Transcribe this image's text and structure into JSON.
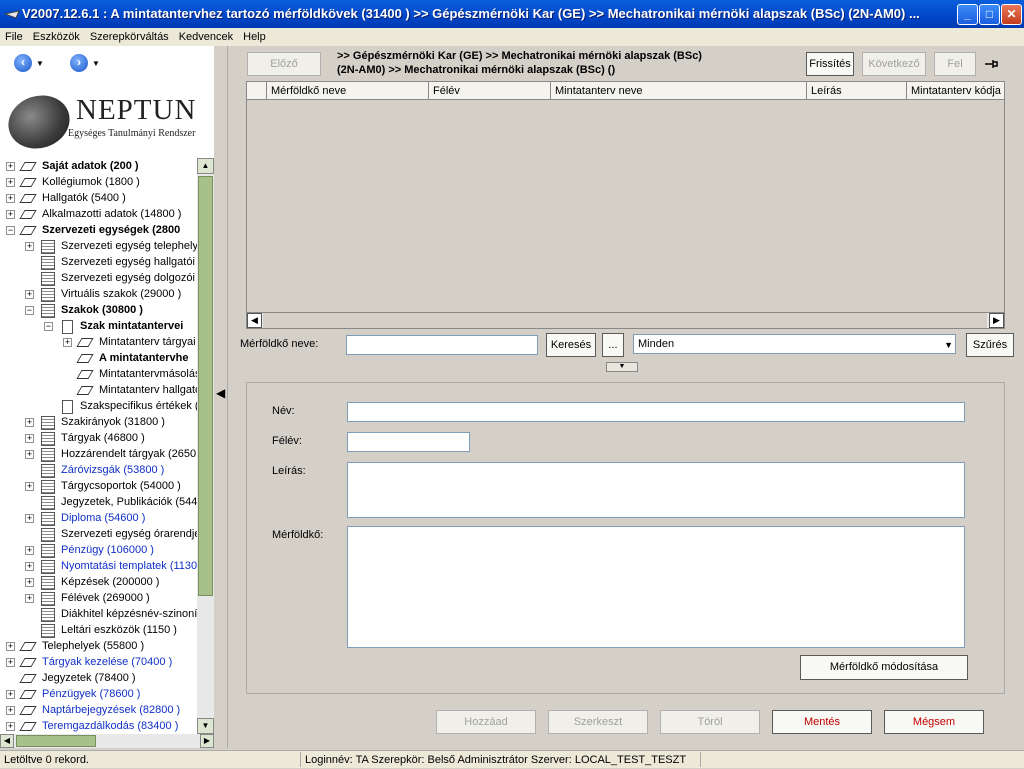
{
  "window": {
    "title": "V2007.12.6.1 : A mintatantervhez tartozó mérföldkövek (31400  ) >> Gépészmérnöki Kar (GE) >> Mechatronikai mérnöki alapszak (BSc) (2N-AM0) ...",
    "minimize": "_",
    "maximize": "□",
    "close": "✕"
  },
  "menu": [
    "File",
    "Eszközök",
    "Szerepkörváltás",
    "Kedvencek",
    "Help"
  ],
  "logo": {
    "title": "NEPTUN",
    "subtitle": "Egységes Tanulmányi Rendszer"
  },
  "tree": [
    {
      "label": "Saját adatok (200  )",
      "level": 0,
      "icon": "book",
      "expander": "+",
      "style": "bold"
    },
    {
      "label": "Kollégiumok (1800  )",
      "level": 0,
      "icon": "book",
      "expander": "+",
      "style": ""
    },
    {
      "label": "Hallgatók (5400  )",
      "level": 0,
      "icon": "book",
      "expander": "+",
      "style": ""
    },
    {
      "label": "Alkalmazotti adatok (14800  )",
      "level": 0,
      "icon": "book",
      "expander": "+",
      "style": ""
    },
    {
      "label": "Szervezeti egységek (2800",
      "level": 0,
      "icon": "book",
      "expander": "−",
      "style": "bold"
    },
    {
      "label": "Szervezeti egység telephelye",
      "level": 1,
      "icon": "folder",
      "expander": "+",
      "style": ""
    },
    {
      "label": "Szervezeti egység hallgatói (",
      "level": 1,
      "icon": "folder",
      "expander": "",
      "style": ""
    },
    {
      "label": "Szervezeti egység dolgozói (",
      "level": 1,
      "icon": "folder",
      "expander": "",
      "style": ""
    },
    {
      "label": "Virtuális szakok (29000  )",
      "level": 1,
      "icon": "folder",
      "expander": "+",
      "style": ""
    },
    {
      "label": "Szakok (30800  )",
      "level": 1,
      "icon": "folder",
      "expander": "−",
      "style": "bold"
    },
    {
      "label": "Szak mintatantervei",
      "level": 2,
      "icon": "doc",
      "expander": "−",
      "style": "bold"
    },
    {
      "label": "Mintatanterv tárgyai",
      "level": 3,
      "icon": "book",
      "expander": "+",
      "style": ""
    },
    {
      "label": "A mintatantervhe",
      "level": 3,
      "icon": "book",
      "expander": "",
      "style": "sel"
    },
    {
      "label": "Mintatantervmásolás",
      "level": 3,
      "icon": "book",
      "expander": "",
      "style": ""
    },
    {
      "label": "Mintatanterv hallgató",
      "level": 3,
      "icon": "book",
      "expander": "",
      "style": ""
    },
    {
      "label": "Szakspecifikus értékek (",
      "level": 2,
      "icon": "doc",
      "expander": "",
      "style": ""
    },
    {
      "label": "Szakirányok (31800  )",
      "level": 1,
      "icon": "folder",
      "expander": "+",
      "style": ""
    },
    {
      "label": "Tárgyak (46800  )",
      "level": 1,
      "icon": "folder",
      "expander": "+",
      "style": ""
    },
    {
      "label": "Hozzárendelt tárgyak (2650",
      "level": 1,
      "icon": "folder",
      "expander": "+",
      "style": ""
    },
    {
      "label": "Záróvizsgák (53800  )",
      "level": 1,
      "icon": "folder",
      "expander": "",
      "style": "blue"
    },
    {
      "label": "Tárgycsoportok (54000  )",
      "level": 1,
      "icon": "folder",
      "expander": "+",
      "style": ""
    },
    {
      "label": "Jegyzetek, Publikációk (544",
      "level": 1,
      "icon": "folder",
      "expander": "",
      "style": ""
    },
    {
      "label": "Diploma (54600  )",
      "level": 1,
      "icon": "folder",
      "expander": "+",
      "style": "blue"
    },
    {
      "label": "Szervezeti egység órarendje",
      "level": 1,
      "icon": "folder",
      "expander": "",
      "style": ""
    },
    {
      "label": "Pénzügy (106000  )",
      "level": 1,
      "icon": "folder",
      "expander": "+",
      "style": "blue"
    },
    {
      "label": "Nyomtatási templatek (1130",
      "level": 1,
      "icon": "folder",
      "expander": "+",
      "style": "blue"
    },
    {
      "label": "Képzések (200000  )",
      "level": 1,
      "icon": "folder",
      "expander": "+",
      "style": ""
    },
    {
      "label": "Félévek (269000  )",
      "level": 1,
      "icon": "folder",
      "expander": "+",
      "style": ""
    },
    {
      "label": "Diákhitel képzésnév-szinoní",
      "level": 1,
      "icon": "folder",
      "expander": "",
      "style": ""
    },
    {
      "label": "Leltári eszközök (1150  )",
      "level": 1,
      "icon": "folder",
      "expander": "",
      "style": ""
    },
    {
      "label": "Telephelyek (55800  )",
      "level": 0,
      "icon": "book",
      "expander": "+",
      "style": ""
    },
    {
      "label": "Tárgyak kezelése (70400  )",
      "level": 0,
      "icon": "book",
      "expander": "+",
      "style": "blue"
    },
    {
      "label": "Jegyzetek (78400  )",
      "level": 0,
      "icon": "book",
      "expander": "",
      "style": ""
    },
    {
      "label": "Pénzügyek (78600  )",
      "level": 0,
      "icon": "book",
      "expander": "+",
      "style": "blue"
    },
    {
      "label": "Naptárbejegyzések (82800  )",
      "level": 0,
      "icon": "book",
      "expander": "+",
      "style": "blue"
    },
    {
      "label": "Teremgazdálkodás (83400  )",
      "level": 0,
      "icon": "book",
      "expander": "+",
      "style": "blue"
    }
  ],
  "toolbar": {
    "prev": "Előző",
    "breadcrumb_line1": ">> Gépészmérnöki Kar (GE) >> Mechatronikai mérnöki alapszak (BSc)",
    "breadcrumb_line2": "(2N-AM0) >> Mechatronikai mérnöki alapszak (BSc) ()",
    "refresh": "Frissítés",
    "next": "Következő",
    "up": "Fel",
    "pin_icon": "pin-icon"
  },
  "grid": {
    "columns": [
      "Mérföldkő neve",
      "Félév",
      "Mintatanterv neve",
      "Leírás",
      "Mintatanterv kódja"
    ],
    "rows": []
  },
  "filter": {
    "label": "Mérföldkő neve:",
    "value": "",
    "search": "Keresés",
    "more": "...",
    "dropdown_value": "Minden",
    "filter_btn": "Szűrés"
  },
  "detail": {
    "name_label": "Név:",
    "semester_label": "Félév:",
    "description_label": "Leírás:",
    "milestone_label": "Mérföldkő:",
    "modify_btn": "Mérföldkő módosítása"
  },
  "actions": {
    "add": "Hozzáad",
    "edit": "Szerkeszt",
    "delete": "Töröl",
    "save": "Mentés",
    "cancel": "Mégsem"
  },
  "status": {
    "records": "Letöltve 0 rekord.",
    "login": "Loginnév: TA   Szerepkör: Belső Adminisztrátor   Szerver: LOCAL_TEST_TESZT"
  }
}
